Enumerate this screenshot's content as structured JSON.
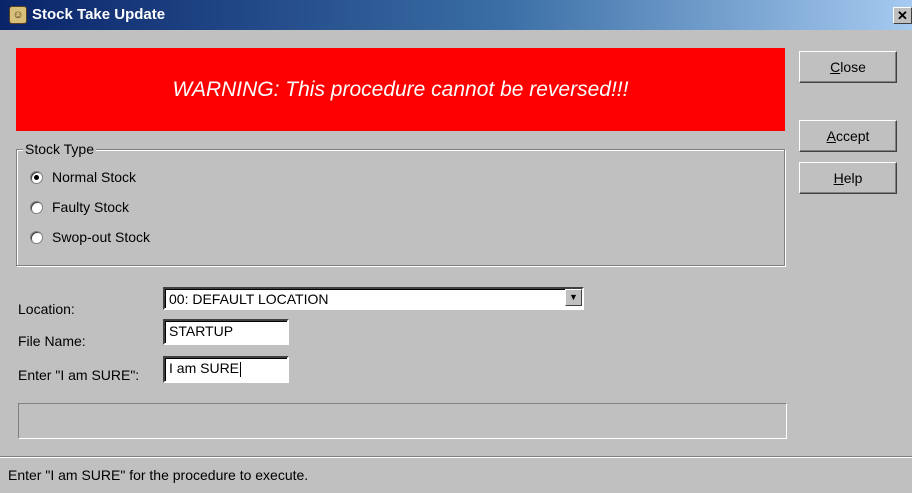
{
  "window": {
    "title": "Stock Take Update",
    "close_glyph": "✕"
  },
  "warning": {
    "text": "WARNING: This procedure cannot be reversed!!!",
    "color": "#ff0000"
  },
  "buttons": {
    "close": "Close",
    "accept": "Accept",
    "help": "Help"
  },
  "stock_type": {
    "label": "Stock Type",
    "options": [
      {
        "label": "Normal Stock",
        "selected": true
      },
      {
        "label": "Faulty Stock",
        "selected": false
      },
      {
        "label": "Swop-out Stock",
        "selected": false
      }
    ]
  },
  "form": {
    "location_label": "Location:",
    "location_value": "00: DEFAULT LOCATION",
    "filename_label": "File Name:",
    "filename_value": "STARTUP",
    "confirm_label": "Enter \"I am SURE\":",
    "confirm_value": "I am SURE"
  },
  "status": {
    "text": "Enter \"I am SURE\" for the procedure to execute."
  },
  "icons": {
    "app": "app-icon",
    "dropdown": "chevron-down-icon"
  }
}
